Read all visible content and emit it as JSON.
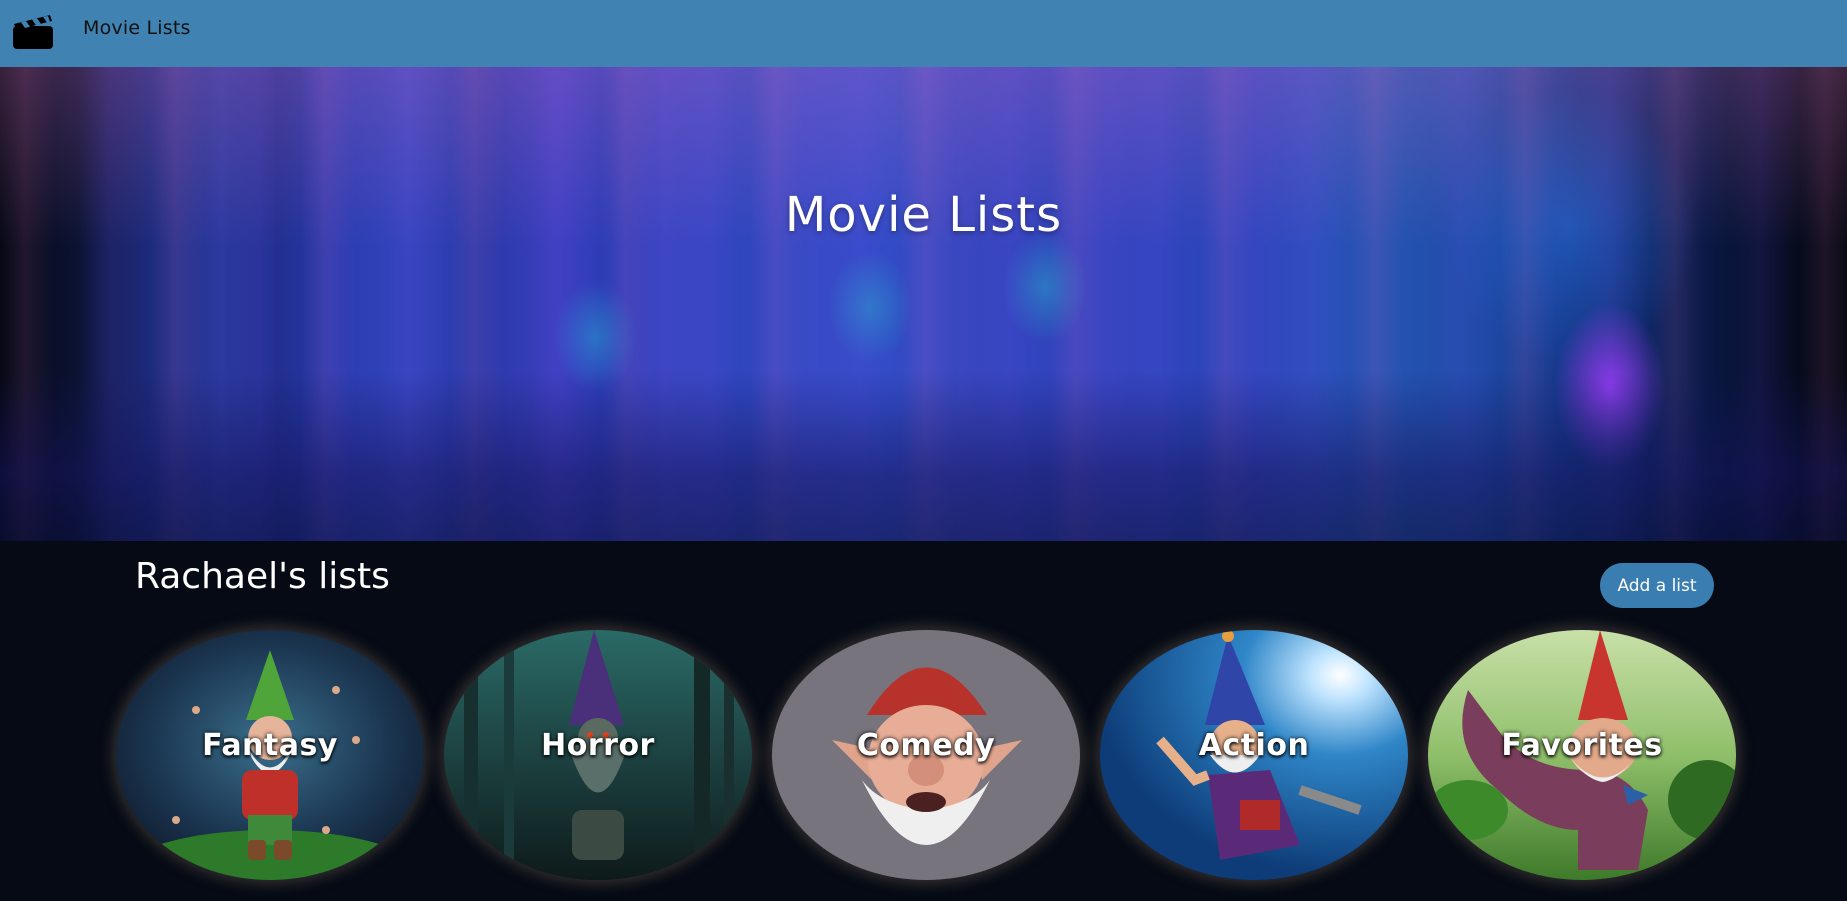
{
  "navbar": {
    "logo_icon": "clapperboard-icon",
    "title": "Movie Lists",
    "background": "#4083b2"
  },
  "hero": {
    "title": "Movie Lists"
  },
  "lists_section": {
    "title": "Rachael's lists",
    "add_button_label": "Add a list",
    "add_button_color": "#3a7db0"
  },
  "lists": [
    {
      "label": "Fantasy",
      "hat_color": "#4fa43a",
      "bg": "#1c3a56"
    },
    {
      "label": "Horror",
      "hat_color": "#4a2f7a",
      "bg": "#173a3a"
    },
    {
      "label": "Comedy",
      "hat_color": "#b8322c",
      "bg": "#78747d"
    },
    {
      "label": "Action",
      "hat_color": "#2f45a8",
      "bg": "#1f6fb0"
    },
    {
      "label": "Favorites",
      "hat_color": "#c8352e",
      "bg": "#7aa878"
    }
  ]
}
